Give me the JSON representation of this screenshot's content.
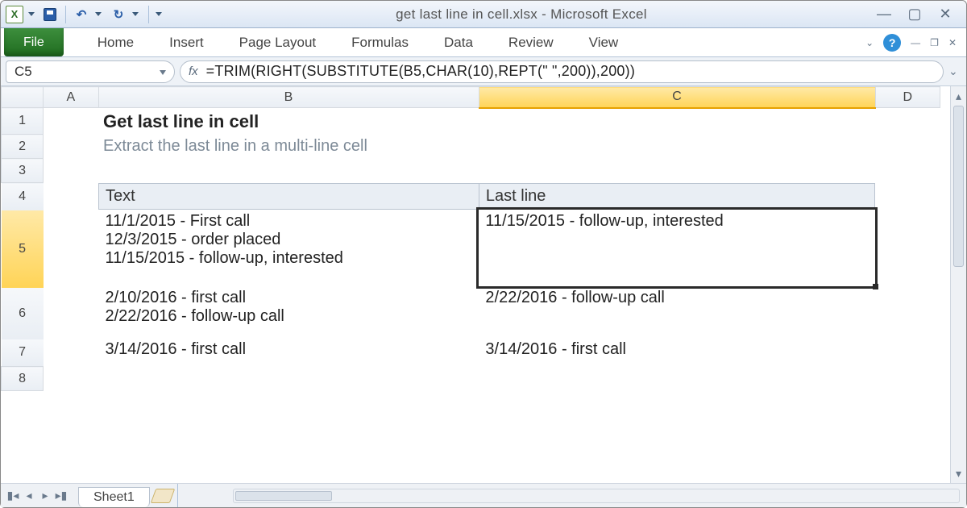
{
  "title": "get last line in cell.xlsx - Microsoft Excel",
  "qat": {
    "undo": "↶",
    "redo": "↻"
  },
  "tabs": {
    "file": "File",
    "home": "Home",
    "insert": "Insert",
    "pagelayout": "Page Layout",
    "formulas": "Formulas",
    "data": "Data",
    "review": "Review",
    "view": "View"
  },
  "help": "?",
  "namebox": "C5",
  "fx": "fx",
  "formula": "=TRIM(RIGHT(SUBSTITUTE(B5,CHAR(10),REPT(\" \",200)),200))",
  "cols": {
    "A": "A",
    "B": "B",
    "C": "C",
    "D": "D"
  },
  "rows": [
    "1",
    "2",
    "3",
    "4",
    "5",
    "6",
    "7",
    "8"
  ],
  "content": {
    "title": "Get last line in cell",
    "subtitle": "Extract the last line in a multi-line cell",
    "headers": {
      "b": "Text",
      "c": "Last line"
    },
    "r5b": "11/1/2015 - First call\n12/3/2015 - order placed\n11/15/2015 - follow-up, interested",
    "r5c": "11/15/2015 - follow-up, interested",
    "r6b": "2/10/2016 - first call\n2/22/2016 - follow-up call",
    "r6c": "2/22/2016 - follow-up call",
    "r7b": "3/14/2016 - first call",
    "r7c": "3/14/2016 - first call"
  },
  "sheet": "Sheet1",
  "nav": {
    "first": "▮◂",
    "prev": "◂",
    "next": "▸",
    "last": "▸▮"
  }
}
